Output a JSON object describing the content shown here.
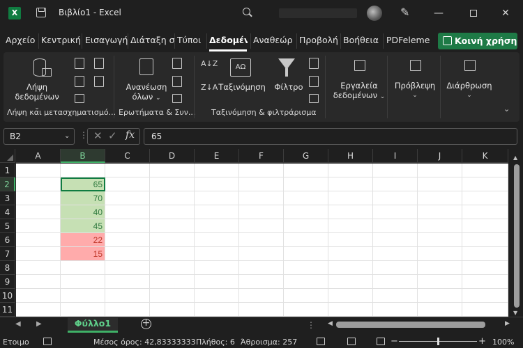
{
  "titlebar": {
    "app_icon": "X",
    "title": "Βιβλίο1  -  Excel",
    "window_min": "—",
    "window_close": "✕"
  },
  "tabs": [
    {
      "label": "Αρχείο"
    },
    {
      "label": "Κεντρική"
    },
    {
      "label": "Εισαγωγή"
    },
    {
      "label": "Διάταξη σ"
    },
    {
      "label": "Τύποι"
    },
    {
      "label": "Δεδομένα",
      "active": true
    },
    {
      "label": "Αναθεώρ"
    },
    {
      "label": "Προβολή"
    },
    {
      "label": "Βοήθεια"
    },
    {
      "label": "PDFeleme"
    }
  ],
  "share_button": "Κοινή χρήση",
  "ribbon": {
    "get_data": {
      "line1": "Λήψη",
      "line2": "δεδομένων"
    },
    "refresh_all": {
      "line1": "Ανανέωση",
      "line2": "όλων"
    },
    "sort_label": "Ταξινόμηση",
    "filter_label": "Φίλτρο",
    "data_tools": {
      "line1": "Εργαλεία",
      "line2": "δεδομένων"
    },
    "forecast": "Πρόβλεψη",
    "outline": "Διάρθρωση",
    "sort_az": "A↓Z",
    "sort_za": "Z↓A",
    "sort_dialog": "ΑΩ",
    "group_labels": {
      "get_transform": "Λήψη και μετασχηματισμό...",
      "queries": "Ερωτήματα & Συν...",
      "sort_filter": "Ταξινόμηση & φιλτράρισμα"
    }
  },
  "formula_bar": {
    "name_box": "B2",
    "x": "✕",
    "check": "✓",
    "fx": "fx",
    "value": "65"
  },
  "columns": [
    "A",
    "B",
    "C",
    "D",
    "E",
    "F",
    "G",
    "H",
    "I",
    "J",
    "K"
  ],
  "rows": [
    "1",
    "2",
    "3",
    "4",
    "5",
    "6",
    "7",
    "8",
    "9",
    "10",
    "11"
  ],
  "cells": [
    {
      "ref": "B2",
      "value": "65",
      "fill": "#c6e0b4",
      "color": "#2f7a3e"
    },
    {
      "ref": "B3",
      "value": "70",
      "fill": "#c6e0b4",
      "color": "#2f7a3e"
    },
    {
      "ref": "B4",
      "value": "40",
      "fill": "#c6e0b4",
      "color": "#2f7a3e"
    },
    {
      "ref": "B5",
      "value": "45",
      "fill": "#c6e0b4",
      "color": "#2f7a3e"
    },
    {
      "ref": "B6",
      "value": "22",
      "fill": "#ffabab",
      "color": "#c0392b"
    },
    {
      "ref": "B7",
      "value": "15",
      "fill": "#ffabab",
      "color": "#c0392b"
    }
  ],
  "selected_cell": "B2",
  "sheet_tab": "Φύλλο1",
  "status": {
    "ready": "Ετοιμο",
    "average": "Μέσος όρος: 42,83333333",
    "count": "Πλήθος: 6",
    "sum": "Άθροισμα: 257",
    "zoom": "100%",
    "zoom_minus": "−",
    "zoom_plus": "+"
  },
  "colors": {
    "accent_green": "#107c41",
    "share_button": "#1e7a46"
  }
}
